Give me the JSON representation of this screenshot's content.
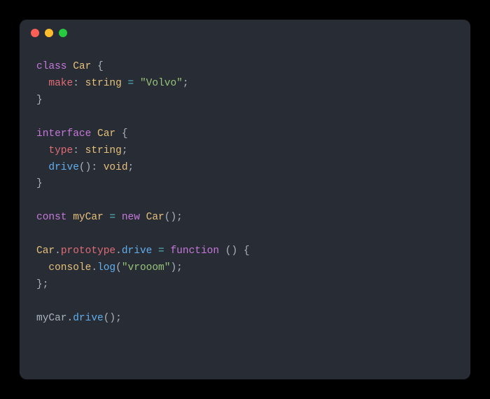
{
  "code": {
    "line1": {
      "kw": "class",
      "cls": "Car",
      "brace": " {"
    },
    "line2": {
      "indent": "  ",
      "prop": "make",
      "colon": ": ",
      "type": "string",
      "eq": " = ",
      "str": "\"Volvo\"",
      "semi": ";"
    },
    "line3": {
      "brace": "}"
    },
    "line4": {
      "blank": ""
    },
    "line5": {
      "kw": "interface",
      "cls": "Car",
      "brace": " {"
    },
    "line6": {
      "indent": "  ",
      "prop": "type",
      "colon": ": ",
      "type": "string",
      "semi": ";"
    },
    "line7": {
      "indent": "  ",
      "fn": "drive",
      "parens": "()",
      "colon": ": ",
      "type": "void",
      "semi": ";"
    },
    "line8": {
      "brace": "}"
    },
    "line9": {
      "blank": ""
    },
    "line10": {
      "kw": "const",
      "var": "myCar",
      "eq": " = ",
      "new": "new",
      "cls": "Car",
      "call": "();"
    },
    "line11": {
      "blank": ""
    },
    "line12": {
      "cls": "Car",
      "dot1": ".",
      "proto": "prototype",
      "dot2": ".",
      "method": "drive",
      "eq": " = ",
      "fnkw": "function",
      "rest": " () {"
    },
    "line13": {
      "indent": "  ",
      "obj": "console",
      "dot": ".",
      "method": "log",
      "open": "(",
      "str": "\"vrooom\"",
      "close": ");"
    },
    "line14": {
      "brace": "};"
    },
    "line15": {
      "blank": ""
    },
    "line16": {
      "var": "myCar",
      "dot": ".",
      "method": "drive",
      "call": "();"
    }
  }
}
